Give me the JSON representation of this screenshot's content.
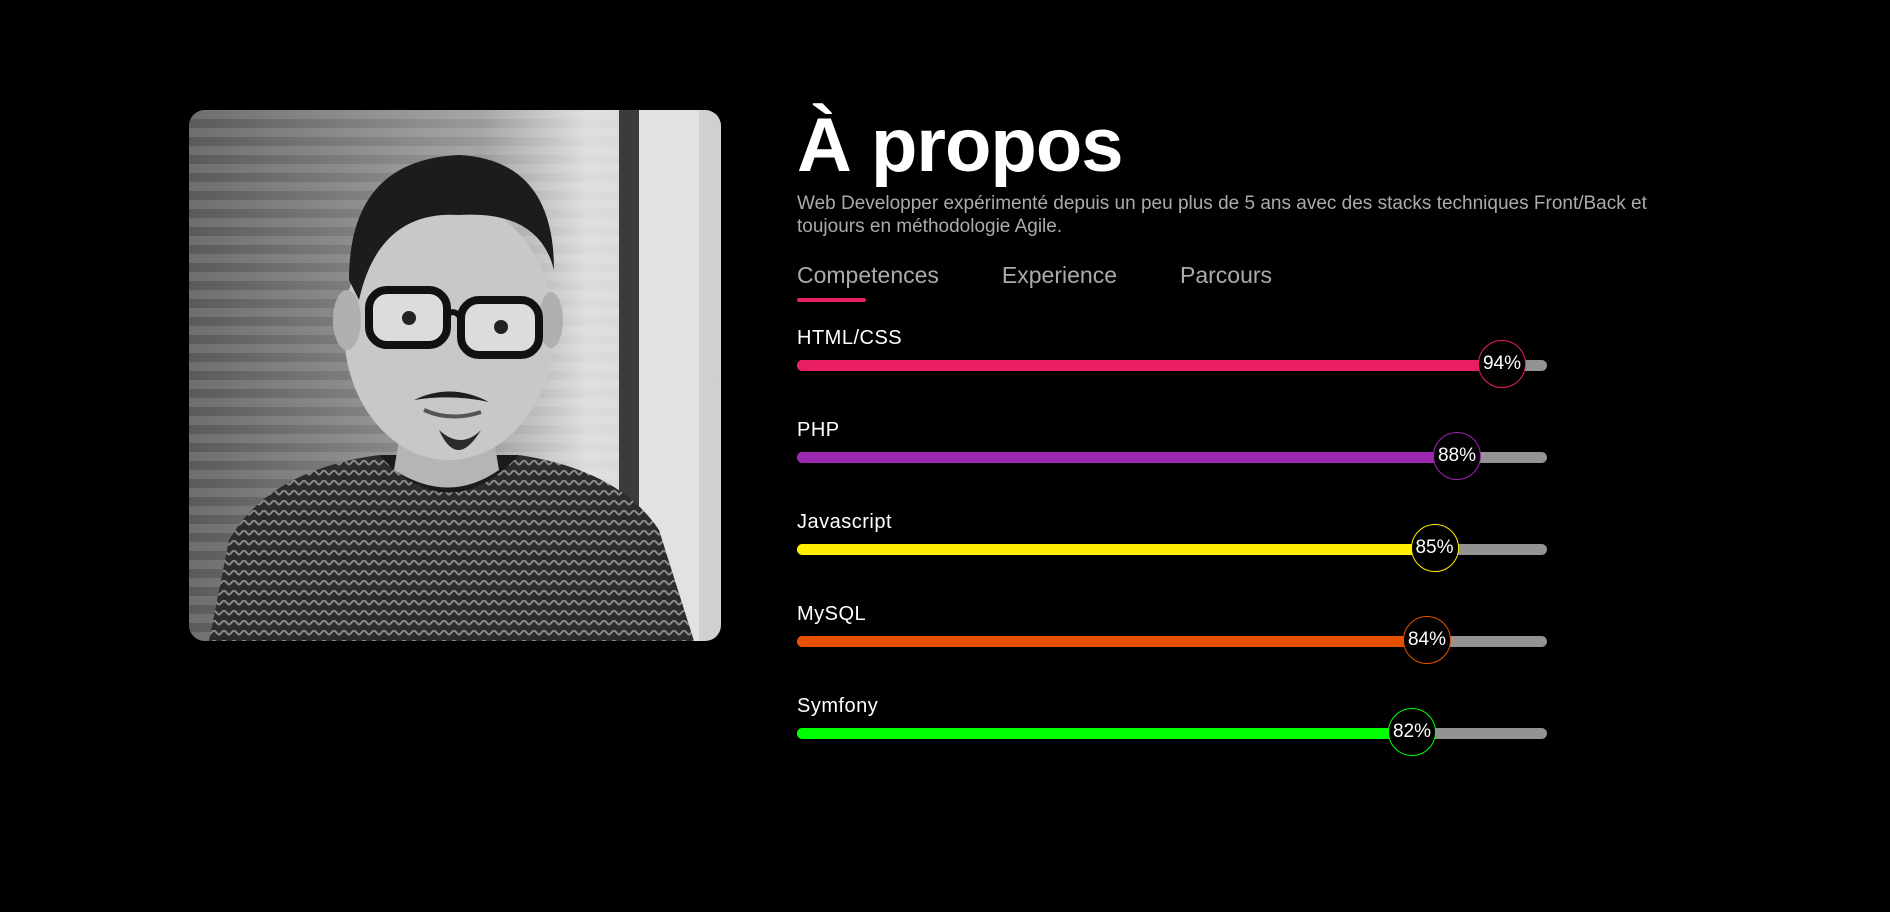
{
  "about": {
    "title": "À propos",
    "description": "Web Developper expérimenté depuis un peu plus de 5 ans avec des stacks techniques Front/Back et toujours en méthodologie Agile."
  },
  "tabs": [
    {
      "label": "Competences",
      "active": true
    },
    {
      "label": "Experience",
      "active": false
    },
    {
      "label": "Parcours",
      "active": false
    }
  ],
  "colors": {
    "accent": "#e91e63",
    "track": "#939393",
    "background": "#000000"
  },
  "skills": [
    {
      "name": "HTML/CSS",
      "percent": 94,
      "percent_label": "94%",
      "color": "#e91e63"
    },
    {
      "name": "PHP",
      "percent": 88,
      "percent_label": "88%",
      "color": "#9c27b0"
    },
    {
      "name": "Javascript",
      "percent": 85,
      "percent_label": "85%",
      "color": "#ffee00"
    },
    {
      "name": "MySQL",
      "percent": 84,
      "percent_label": "84%",
      "color": "#e65100"
    },
    {
      "name": "Symfony",
      "percent": 82,
      "percent_label": "82%",
      "color": "#00ff00"
    }
  ]
}
